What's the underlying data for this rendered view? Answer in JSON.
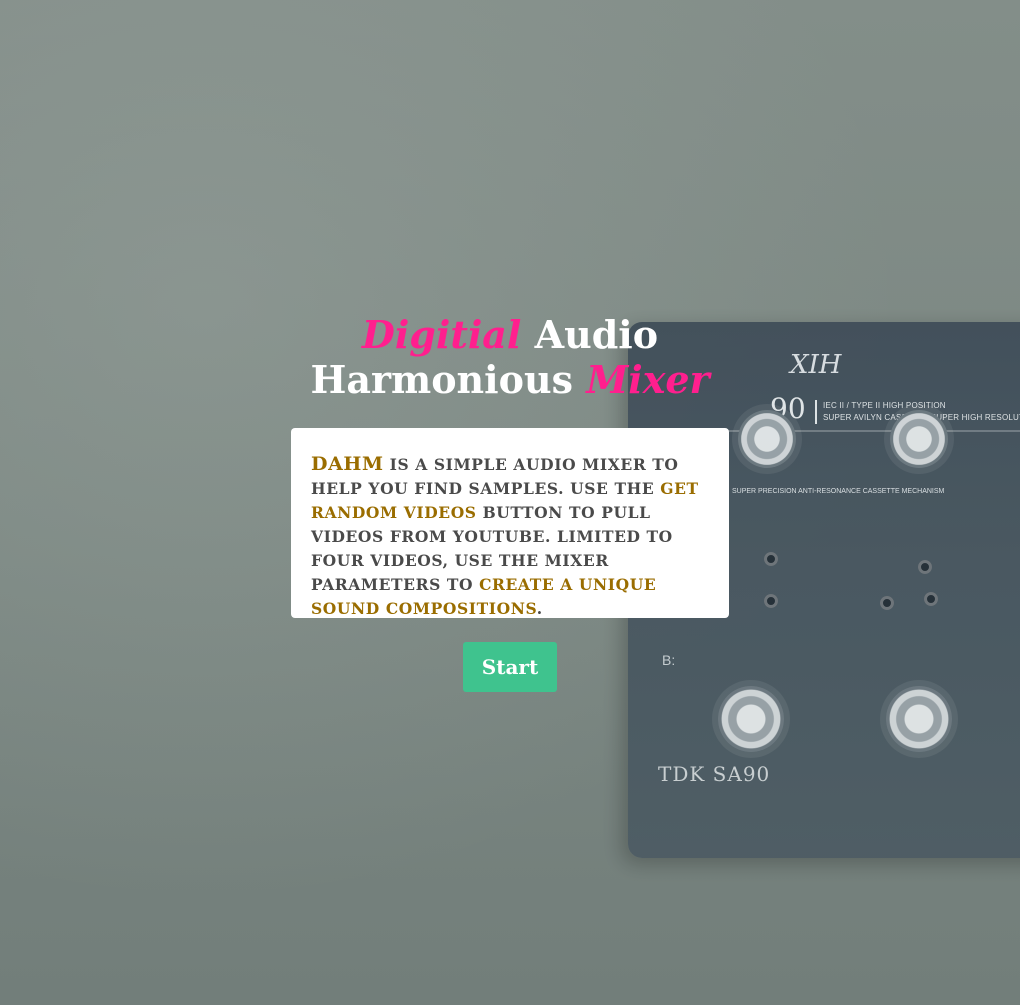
{
  "title": {
    "word1": "Digitial",
    "word2": "Audio",
    "word3": "Harmonious",
    "word4": "Mixer"
  },
  "colors": {
    "accent_pink": "#ff1f8e",
    "highlight_gold": "#9a6d00",
    "start_green": "#3fc38e",
    "card_text": "#4a4a4a"
  },
  "intro": {
    "brand": "DAHM",
    "part1": " is a simple audio mixer to help you find samples. Use the ",
    "highlight1": "Get Random Videos",
    "part2": " button to pull videos from YouTube. Limited to four videos, use the mixer parameters to ",
    "highlight2": "create a unique sound compositions",
    "part3": "."
  },
  "start_button": {
    "label": "Start"
  },
  "background": {
    "cassette_number": "90",
    "cassette_handwriting": "XIH",
    "cassette_spec_line1": "IEC II / TYPE II  HIGH POSITION",
    "cassette_spec_line2": "SUPER AVILYN CASSETTE SUPER HIGH RESOLUTION",
    "cassette_mechanism": "SUPER PRECISION ANTI-RESONANCE CASSETTE MECHANISM",
    "cassette_side": "B:",
    "cassette_brand": "TDK SA90"
  }
}
